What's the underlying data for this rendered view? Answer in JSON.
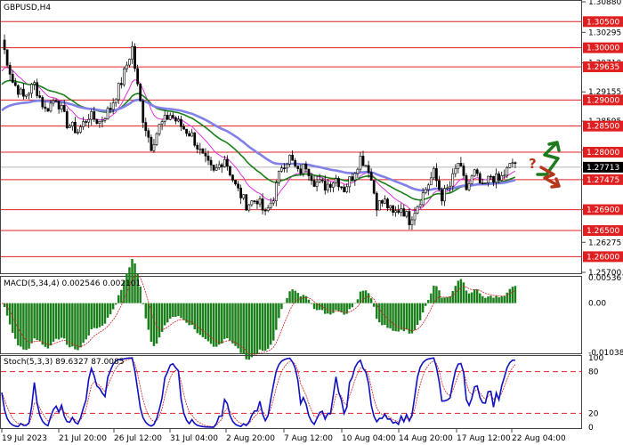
{
  "chart_data": {
    "type": "candlestick",
    "symbol_title": "GBPUSD,H4",
    "current_price": "1.27713",
    "y_ticks": [
      "1.30880",
      "1.30295",
      "1.29710",
      "1.29155",
      "1.28595",
      "1.28040",
      "1.27475",
      "1.26905",
      "1.26275",
      "1.25700"
    ],
    "levels": [
      {
        "label": "1.30500",
        "value": 1.305
      },
      {
        "label": "1.30000",
        "value": 1.3
      },
      {
        "label": "1.29635",
        "value": 1.29635
      },
      {
        "label": "1.29000",
        "value": 1.29
      },
      {
        "label": "1.28500",
        "value": 1.285
      },
      {
        "label": "1.28000",
        "value": 1.28
      },
      {
        "label": "1.27475",
        "value": 1.27475
      },
      {
        "label": "1.26900",
        "value": 1.269
      },
      {
        "label": "1.26500",
        "value": 1.265
      },
      {
        "label": "1.26000",
        "value": 1.26
      }
    ],
    "x_labels": [
      "19 Jul 2023",
      "21 Jul 20:00",
      "26 Jul 12:00",
      "31 Jul 04:00",
      "2 Aug 20:00",
      "7 Aug 12:00",
      "10 Aug 04:00",
      "14 Aug 20:00",
      "17 Aug 12:00",
      "22 Aug 04:00"
    ],
    "price_path": [
      [
        0,
        1.3015
      ],
      [
        4,
        1.2935
      ],
      [
        8,
        1.2905
      ],
      [
        12,
        1.293
      ],
      [
        16,
        1.288
      ],
      [
        20,
        1.2905
      ],
      [
        24,
        1.2855
      ],
      [
        28,
        1.284
      ],
      [
        32,
        1.287
      ],
      [
        36,
        1.2858
      ],
      [
        40,
        1.2885
      ],
      [
        44,
        1.2935
      ],
      [
        48,
        1.3
      ],
      [
        50,
        1.2925
      ],
      [
        52,
        1.2865
      ],
      [
        55,
        1.2812
      ],
      [
        58,
        1.285
      ],
      [
        62,
        1.2872
      ],
      [
        66,
        1.285
      ],
      [
        70,
        1.2832
      ],
      [
        74,
        1.279
      ],
      [
        78,
        1.276
      ],
      [
        82,
        1.279
      ],
      [
        86,
        1.2735
      ],
      [
        90,
        1.27
      ],
      [
        94,
        1.271
      ],
      [
        97,
        1.268
      ],
      [
        100,
        1.2715
      ],
      [
        103,
        1.2775
      ],
      [
        106,
        1.279
      ],
      [
        109,
        1.276
      ],
      [
        112,
        1.2775
      ],
      [
        115,
        1.2745
      ],
      [
        119,
        1.2735
      ],
      [
        123,
        1.275
      ],
      [
        126,
        1.273
      ],
      [
        129,
        1.2755
      ],
      [
        132,
        1.279
      ],
      [
        135,
        1.277
      ],
      [
        138,
        1.27
      ],
      [
        141,
        1.2705
      ],
      [
        144,
        1.268
      ],
      [
        147,
        1.2695
      ],
      [
        150,
        1.267
      ],
      [
        153,
        1.27
      ],
      [
        156,
        1.273
      ],
      [
        159,
        1.276
      ],
      [
        162,
        1.2715
      ],
      [
        165,
        1.2735
      ],
      [
        168,
        1.278
      ],
      [
        171,
        1.273
      ],
      [
        174,
        1.276
      ],
      [
        177,
        1.273
      ],
      [
        180,
        1.2755
      ],
      [
        183,
        1.2745
      ],
      [
        186,
        1.2765
      ],
      [
        188,
        1.278
      ]
    ],
    "indicators": {
      "macd": {
        "label": "MACD(5,34,4) 0.002546 0.002101",
        "ticks": [
          "0.005367",
          "0.00",
          "-0.010381"
        ],
        "ylim": [
          -0.010381,
          0.005367
        ]
      },
      "stoch": {
        "label": "Stoch(5,3,3) 89.6327 87.0085",
        "ticks": [
          "100",
          "80",
          "20",
          "0"
        ],
        "levels": [
          80,
          20
        ],
        "ylim": [
          0,
          100
        ]
      }
    },
    "forecast": {
      "up_color": "#1f7a1f",
      "down_color": "#b5371b",
      "question_mark": "?"
    },
    "colors": {
      "level_line": "#e02020",
      "label_bg": "#e02020",
      "price_tag_bg": "#000000",
      "ma_fast": "#e030e0",
      "ma_mid": "#1a7f1a",
      "ma_slow": "#8080e8",
      "macd_bar": "#1a7f1a",
      "macd_signal": "#d02020",
      "stoch_main": "#1010c0",
      "stoch_signal": "#d02020"
    }
  }
}
